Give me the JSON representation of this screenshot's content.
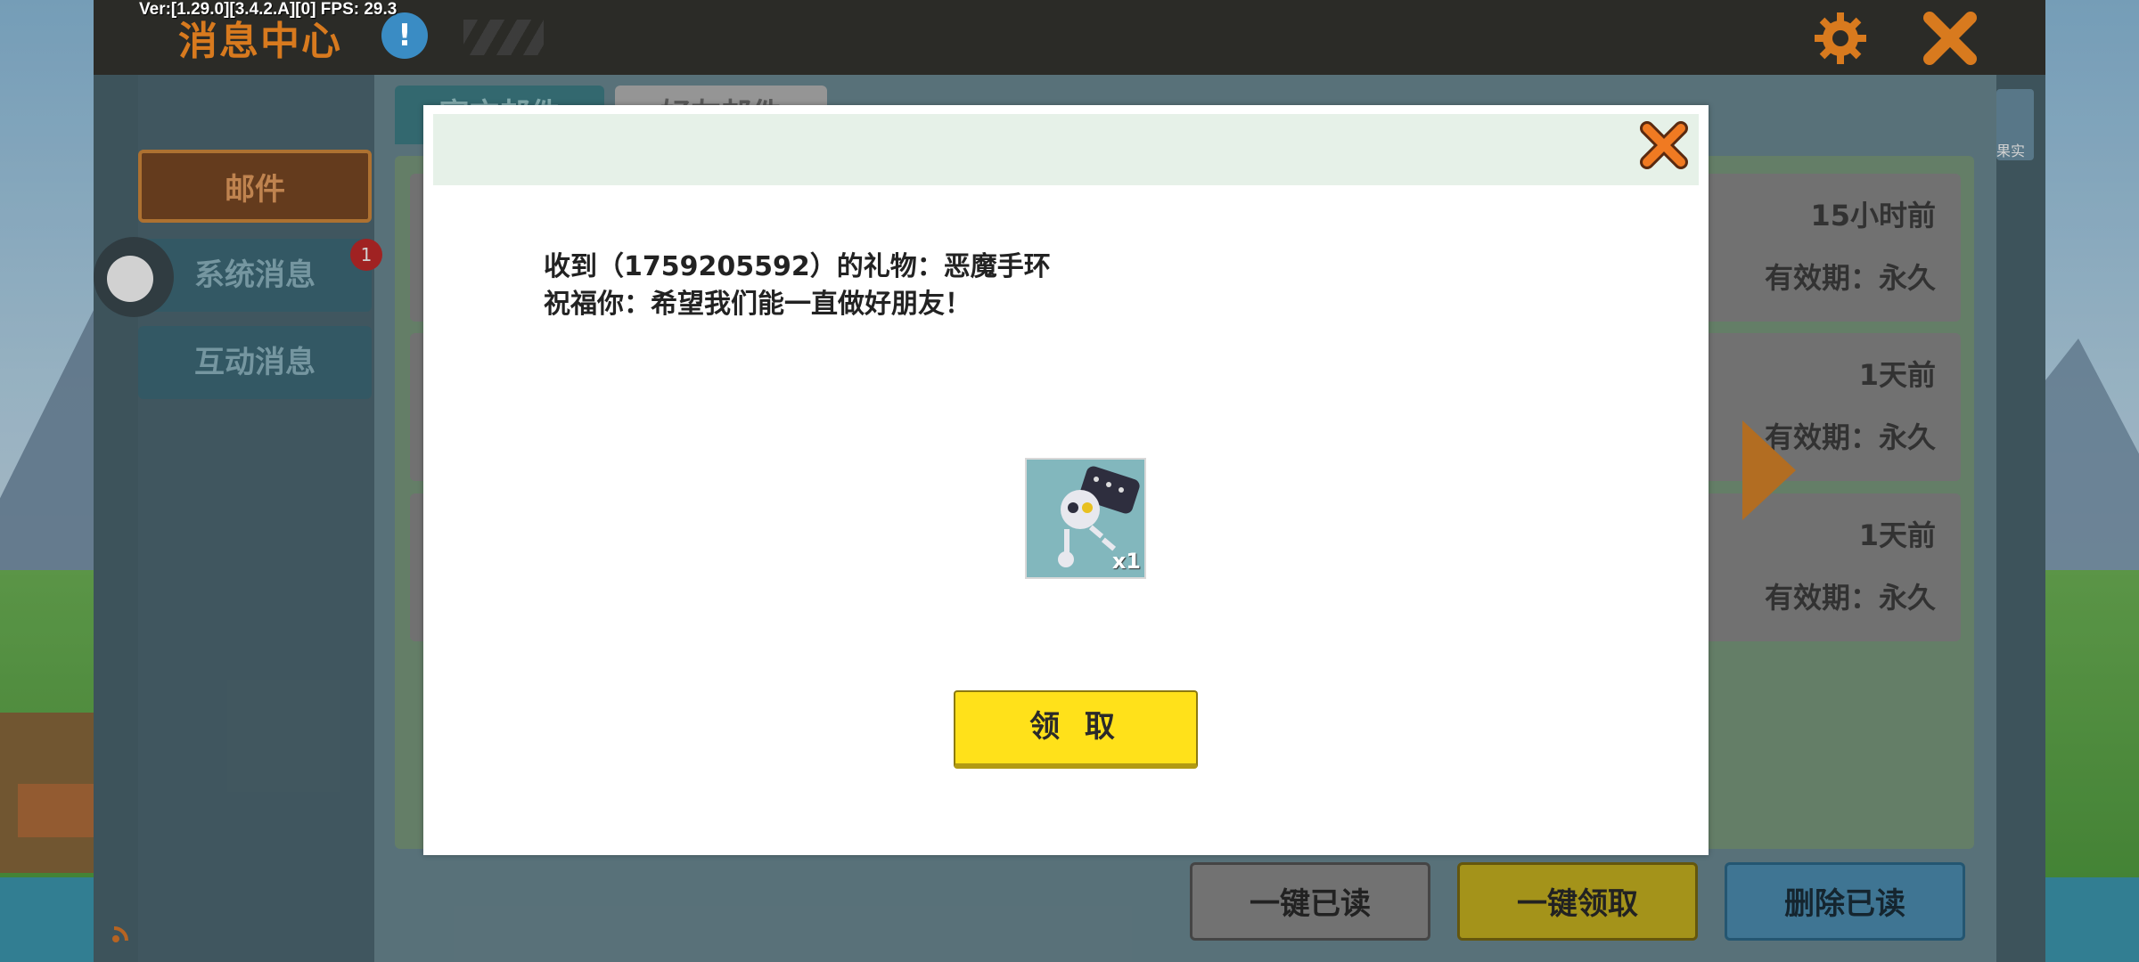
{
  "debug": {
    "version_text": "Ver:[1.29.0][3.4.2.A][0] FPS: 29.3"
  },
  "header": {
    "title": "消息中心",
    "info_icon": "!"
  },
  "sidebar": {
    "items": [
      {
        "label": "邮件"
      },
      {
        "label": "系统消息",
        "badge": "1"
      },
      {
        "label": "互动消息"
      }
    ]
  },
  "tabs": [
    {
      "label": "官方邮件"
    },
    {
      "label": "好友邮件"
    }
  ],
  "mail_rows": [
    {
      "time": "15小时前",
      "expiry": "有效期：永久"
    },
    {
      "time": "1天前",
      "expiry": "有效期：永久"
    },
    {
      "time": "1天前",
      "expiry": "有效期：永久"
    }
  ],
  "bottom_buttons": {
    "mark_all_read": "一键已读",
    "claim_all": "一键领取",
    "delete_read": "删除已读"
  },
  "corner_label": "果实",
  "modal": {
    "line1": "收到（1759205592）的礼物：恶魔手环",
    "line2": "祝福你：希望我们能一直做好朋友！",
    "item_quantity": "x1",
    "claim_label": "领 取"
  },
  "colors": {
    "accent_orange": "#d87a1e",
    "claim_yellow": "#ffe11a",
    "header_dark": "#2b2b27"
  }
}
